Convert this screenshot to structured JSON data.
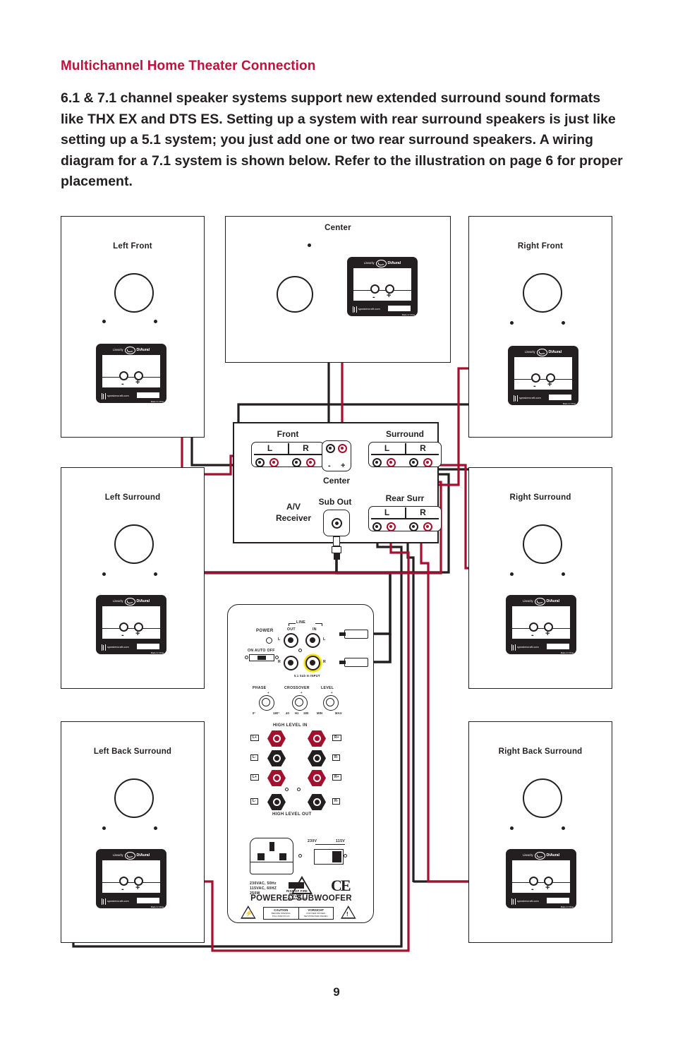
{
  "heading": "Multichannel Home Theater Connection",
  "intro": "6.1 & 7.1 channel speaker systems support new extended surround sound formats like THX EX and DTS ES. Setting up a system with rear surround speakers is just like setting up a 5.1 system; you just add one or two rear surround speakers. A wiring diagram for a 7.1 system is shown below. Refer to the illustration on page 6 for proper placement.",
  "page_number": "9",
  "colors": {
    "heading_red": "#c2103c",
    "wire_red": "#a3112f",
    "wire_black": "#231f20",
    "highlight_yellow": "#f5e400",
    "plate_black": "#231f20"
  },
  "speakers": [
    {
      "id": "left-front",
      "label": "Left Front"
    },
    {
      "id": "center",
      "label": "Center"
    },
    {
      "id": "right-front",
      "label": "Right Front"
    },
    {
      "id": "left-surround",
      "label": "Left Surround"
    },
    {
      "id": "right-surround",
      "label": "Right Surround"
    },
    {
      "id": "left-back-surround",
      "label": "Left Back Surround"
    },
    {
      "id": "right-back-surround",
      "label": "Right Back Surround"
    }
  ],
  "plate": {
    "brand_small": "Linearity",
    "brand_main": "DiAural",
    "neg": "-",
    "pos": "+",
    "url": "speakercraft.com",
    "made_in": "Made In China"
  },
  "receiver": {
    "title_line1": "A/V",
    "title_line2": "Receiver",
    "groups": [
      {
        "id": "front",
        "label": "Front",
        "left": "L",
        "right": "R",
        "neg": "-",
        "pos": "+"
      },
      {
        "id": "surround",
        "label": "Surround",
        "left": "L",
        "right": "R",
        "neg": "-",
        "pos": "+"
      },
      {
        "id": "rear",
        "label": "Rear Surr",
        "left": "L",
        "right": "R",
        "neg": "-",
        "pos": "+"
      }
    ],
    "center_label": "Center",
    "center_neg": "-",
    "center_pos": "+",
    "sub_out_label": "Sub Out"
  },
  "subwoofer": {
    "title": "POWERED SUBWOOFER",
    "power_label": "POWER",
    "power_switch_label": "ON AUTO OFF",
    "line_label": "LINE",
    "line_out": "OUT",
    "line_in": "IN",
    "ch_l": "L",
    "ch_r": "R",
    "sub_in_note": "5.1 Sub In INPUT",
    "knobs": [
      {
        "name": "PHASE",
        "min": "0°",
        "mid": "",
        "max": "180°"
      },
      {
        "name": "CROSSOVER",
        "min": "40",
        "mid": "Hz",
        "max": "180"
      },
      {
        "name": "LEVEL",
        "min": "MIN",
        "mid": "",
        "max": "MAX"
      }
    ],
    "high_level_in": "HIGH LEVEL IN",
    "high_level_out": "HIGH LEVEL OUT",
    "post_labels": {
      "lp": "L+",
      "rp": "R+",
      "lm": "L-",
      "rm": "R-"
    },
    "voltage_230": "230V",
    "voltage_115": "115V",
    "ratings": "230VAC, 50Hz\n115VAC, 60HZ\n250W",
    "risk_box": "RISK OF FIRE\nREPLACE FUSE\nAS MARKED",
    "ce_mark": "CE",
    "caution": {
      "head_left": "CAUTION",
      "head_right": "VORSICHT",
      "body_left": "BEFORE OPENING\nPULL MAIN PLUG",
      "body_right": "VOR DEM ÖFFNEN\nNETZSTECKER ZIEHEN"
    }
  }
}
